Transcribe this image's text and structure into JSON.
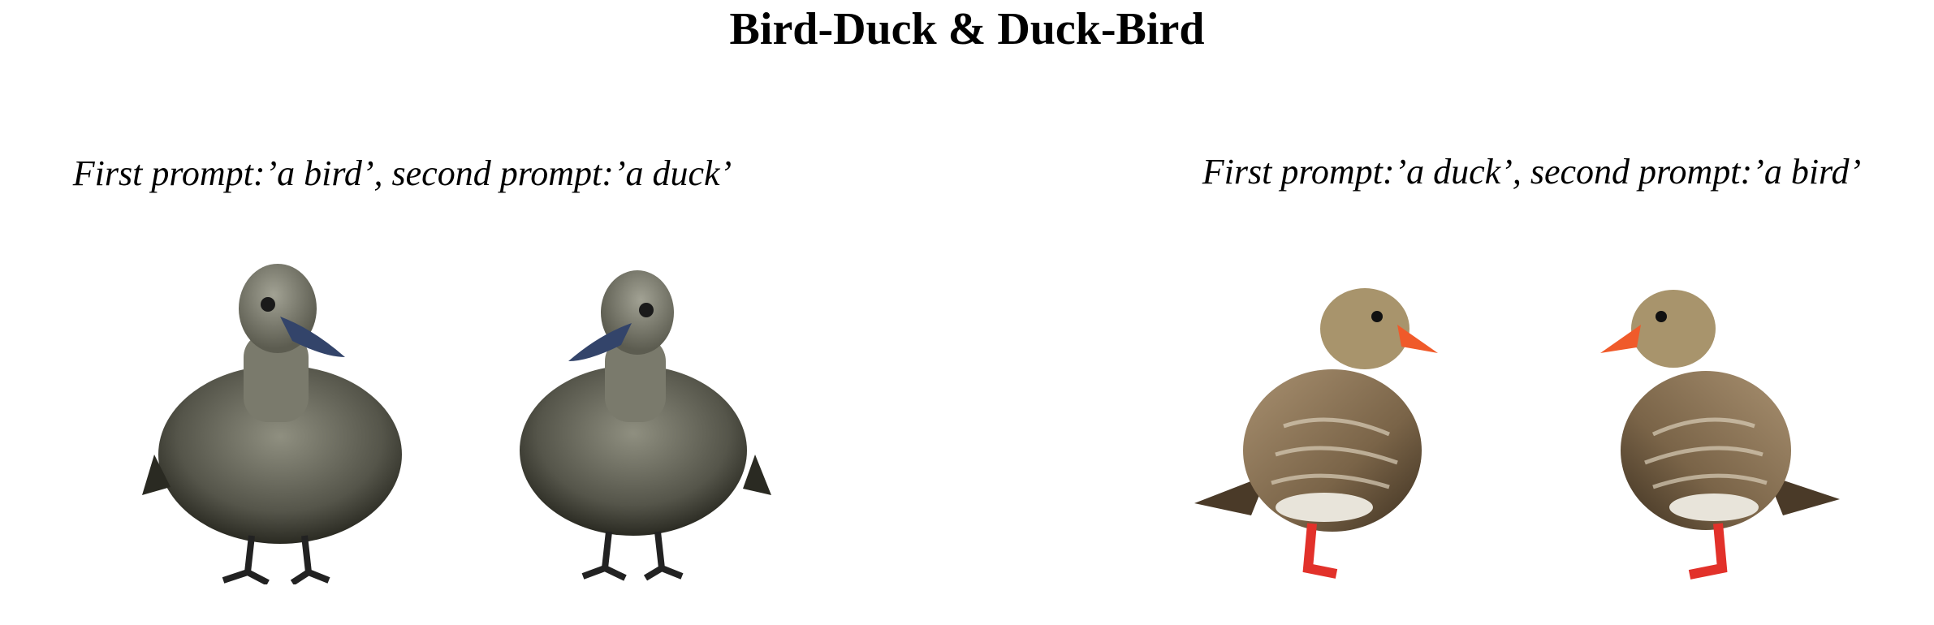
{
  "title": "Bird-Duck & Duck-Bird",
  "panels": [
    {
      "caption": "First prompt:’a bird’, second prompt:’a duck’"
    },
    {
      "caption": "First prompt:’a duck’, second prompt:’a bird’"
    }
  ],
  "colors": {
    "background": "#ffffff",
    "grey_duck_body": "#6e6e60",
    "grey_duck_beak": "#33446a",
    "brown_duck_body": "#8a7458",
    "brown_duck_beak": "#f05a2a",
    "brown_duck_feet": "#e2312a"
  }
}
